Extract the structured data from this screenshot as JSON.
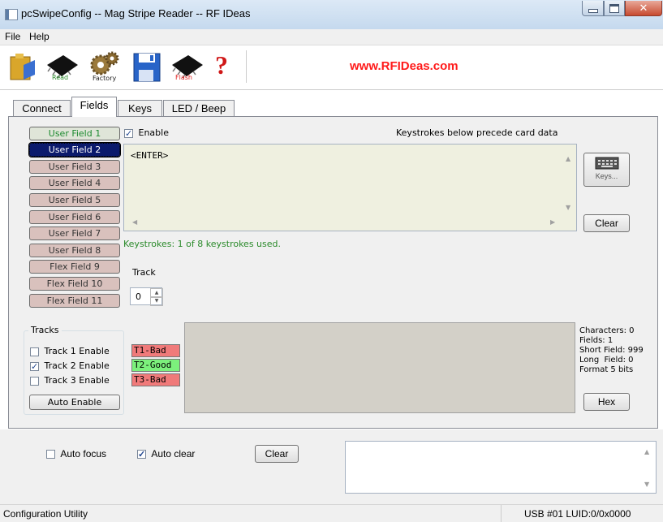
{
  "window": {
    "title": "pcSwipeConfig -- Mag Stripe Reader -- RF IDeas"
  },
  "menu": {
    "items": [
      "File",
      "Help"
    ]
  },
  "toolbar": {
    "read_label": "Read",
    "factory_label": "Factory",
    "flash_label": "Flash",
    "help_symbol": "?",
    "url": "www.RFIDeas.com",
    "url_color": "#ff1a1a"
  },
  "tabs": [
    "Connect",
    "Fields",
    "Keys",
    "LED / Beep"
  ],
  "active_tab": "Fields",
  "fields": {
    "buttons": [
      "User Field 1",
      "User Field 2",
      "User Field 3",
      "User Field 4",
      "User Field 5",
      "User Field 6",
      "User Field 7",
      "User Field 8",
      "Flex Field 9",
      "Flex Field 10",
      "Flex Field 11"
    ],
    "selected": "User Field 2",
    "enable_label": "Enable",
    "enable_checked": true,
    "precede_label": "Keystrokes below precede card data",
    "keystrokes_text": "<ENTER>",
    "keys_button": "Keys...",
    "clear_button": "Clear",
    "keystrokes_used": "Keystrokes: 1 of 8 keystrokes used.",
    "track_label": "Track",
    "track_value": "0"
  },
  "tracks": {
    "title": "Tracks",
    "items": [
      {
        "label": "Track 1 Enable",
        "checked": false
      },
      {
        "label": "Track 2 Enable",
        "checked": true
      },
      {
        "label": "Track 3 Enable",
        "checked": false
      }
    ],
    "auto_enable": "Auto Enable",
    "status": [
      {
        "text": "T1-Bad",
        "color": "#f07a7a"
      },
      {
        "text": "T2-Good",
        "color": "#7cf07c"
      },
      {
        "text": "T3-Bad",
        "color": "#f07a7a"
      }
    ]
  },
  "stats": {
    "lines": [
      "Characters: 0",
      "Fields: 1",
      "Short Field: 999",
      "Long  Field: 0",
      "Format 5 bits"
    ],
    "hex_button": "Hex"
  },
  "bottom": {
    "auto_focus_label": "Auto focus",
    "auto_focus_checked": false,
    "auto_clear_label": "Auto clear",
    "auto_clear_checked": true,
    "clear_button": "Clear"
  },
  "status": {
    "left": "Configuration Utility",
    "right": "USB #01 LUID:0/0x0000"
  }
}
